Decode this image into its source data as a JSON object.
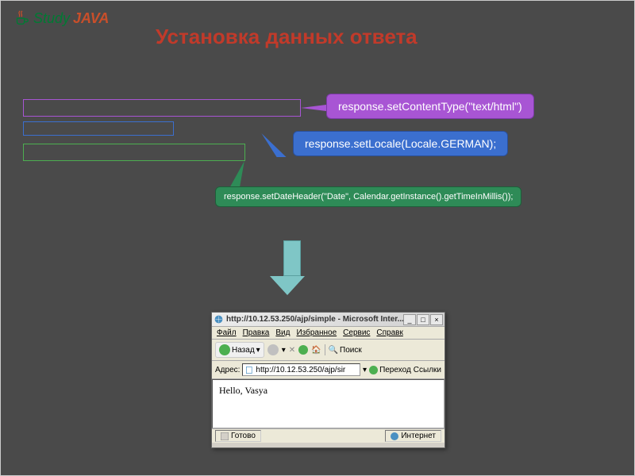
{
  "logo": {
    "text1": "Study",
    "text2": "JAVA"
  },
  "title": "Установка данных ответа",
  "callouts": {
    "purple": "response.setContentType(\"text/html\")",
    "blue": "response.setLocale(Locale.GERMAN);",
    "green": "response.setDateHeader(\"Date\", Calendar.getInstance().getTimeInMillis());"
  },
  "browser": {
    "title": "http://10.12.53.250/ajp/simple - Microsoft Inter...",
    "menu": {
      "file": "Файл",
      "edit": "Правка",
      "view": "Вид",
      "favorites": "Избранное",
      "tools": "Сервис",
      "help": "Справк"
    },
    "toolbar": {
      "back": "Назад",
      "search": "Поиск"
    },
    "address": {
      "label": "Адрес:",
      "url": "http://10.12.53.250/ajp/sir",
      "go": "Переход",
      "links": "Ссылки"
    },
    "content": "Hello, Vasya",
    "status": {
      "ready": "Готово",
      "zone": "Интернет"
    }
  }
}
